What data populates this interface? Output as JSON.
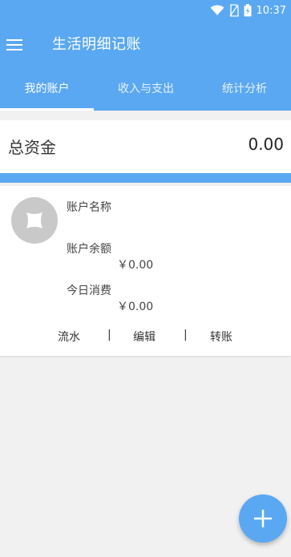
{
  "status_bar": {
    "time": "10:37",
    "icons": [
      "wifi-icon",
      "no-sim-icon",
      "battery-charging-icon"
    ]
  },
  "app_bar": {
    "title": "生活明细记账",
    "menu_icon": "menu-icon"
  },
  "tabs": [
    {
      "label": "我的账户",
      "active": true
    },
    {
      "label": "收入与支出",
      "active": false
    },
    {
      "label": "统计分析",
      "active": false
    }
  ],
  "summary": {
    "label": "总资金",
    "value": "0.00"
  },
  "account": {
    "avatar_icon": "avatar-placeholder-icon",
    "name_label": "账户名称",
    "balance_label": "账户余额",
    "balance_value": "￥0.00",
    "today_label": "今日消费",
    "today_value": "￥0.00",
    "actions": {
      "flow": "流水",
      "separator": "|",
      "edit": "编辑",
      "transfer": "转账"
    }
  },
  "fab": {
    "icon": "plus-icon"
  },
  "colors": {
    "primary": "#5aa8f2",
    "background": "#f1f1f1",
    "card": "#ffffff"
  }
}
